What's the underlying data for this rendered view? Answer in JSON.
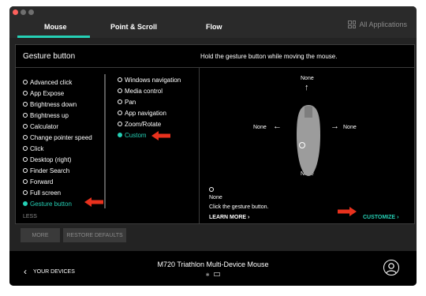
{
  "tabs": [
    {
      "label": "Mouse",
      "active": true
    },
    {
      "label": "Point & Scroll",
      "active": false
    },
    {
      "label": "Flow",
      "active": false
    }
  ],
  "all_apps_label": "All Applications",
  "panel": {
    "title": "Gesture button",
    "instruction": "Hold the gesture button while moving the mouse."
  },
  "action_list": [
    {
      "label": "Advanced click",
      "selected": false
    },
    {
      "label": "App Expose",
      "selected": false
    },
    {
      "label": "Brightness down",
      "selected": false
    },
    {
      "label": "Brightness up",
      "selected": false
    },
    {
      "label": "Calculator",
      "selected": false
    },
    {
      "label": "Change pointer speed",
      "selected": false
    },
    {
      "label": "Click",
      "selected": false
    },
    {
      "label": "Desktop (right)",
      "selected": false
    },
    {
      "label": "Finder Search",
      "selected": false
    },
    {
      "label": "Forward",
      "selected": false
    },
    {
      "label": "Full screen",
      "selected": false
    },
    {
      "label": "Gesture button",
      "selected": true
    }
  ],
  "less_label": "LESS",
  "gesture_options": [
    {
      "label": "Windows navigation",
      "selected": false
    },
    {
      "label": "Media control",
      "selected": false
    },
    {
      "label": "Pan",
      "selected": false
    },
    {
      "label": "App navigation",
      "selected": false
    },
    {
      "label": "Zoom/Rotate",
      "selected": false
    },
    {
      "label": "Custom",
      "selected": true
    }
  ],
  "directions": {
    "up": "None",
    "down": "None",
    "left": "None",
    "right": "None"
  },
  "click_action": {
    "value": "None",
    "description": "Click the gesture button.",
    "learn_more": "LEARN MORE",
    "customize": "CUSTOMIZE"
  },
  "buttons": {
    "more": "MORE",
    "restore_defaults": "RESTORE DEFAULTS"
  },
  "footer": {
    "your_devices": "YOUR DEVICES",
    "device_name": "M720 Triathlon Multi-Device Mouse"
  },
  "colors": {
    "accent": "#25d0b5",
    "annotation_arrow": "#e8311d",
    "background": "#232323"
  }
}
